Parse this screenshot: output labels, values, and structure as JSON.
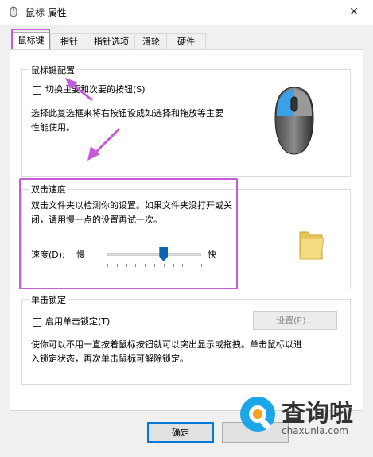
{
  "window": {
    "title": "鼠标 属性",
    "close_symbol": "✕"
  },
  "tabs": [
    {
      "label": "鼠标键",
      "active": true
    },
    {
      "label": "指针",
      "active": false
    },
    {
      "label": "指针选项",
      "active": false
    },
    {
      "label": "滑轮",
      "active": false
    },
    {
      "label": "硬件",
      "active": false
    }
  ],
  "button_config": {
    "title": "鼠标键配置",
    "switch_checkbox_label": "切换主要和次要的按钮(S)",
    "switch_checked": false,
    "description_line1": "选择此复选框来将右按钮设成如选择和拖放等主要",
    "description_line2": "性能使用。"
  },
  "double_click": {
    "title": "双击速度",
    "description_line1": "双击文件夹以检测你的设置。如果文件夹没打开或关",
    "description_line2": "闭，请用慢一点的设置再试一次。",
    "speed_label": "速度(D):",
    "slow_label": "慢",
    "fast_label": "快",
    "speed_fraction": 0.6
  },
  "click_lock": {
    "title": "单击锁定",
    "checkbox_label": "启用单击锁定(T)",
    "checked": false,
    "settings_button": "设置(E)...",
    "description_line1": "使你可以不用一直按着鼠标按钮就可以突出显示或拖拽。单击鼠标以进",
    "description_line2": "入锁定状态，再次单击鼠标可解除锁定。"
  },
  "footer": {
    "ok_button": "确定"
  },
  "watermark": {
    "text_cn": "查询啦",
    "text_url": "chaxunla.com",
    "brand_color": "#1aa6e8"
  },
  "colors": {
    "highlight": "#c65bd8",
    "accent": "#0078d7"
  }
}
